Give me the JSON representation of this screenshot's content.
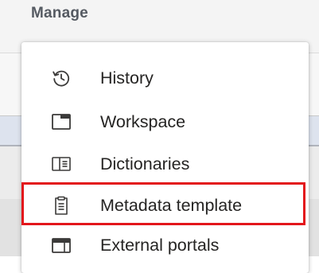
{
  "header": {
    "title": "Manage"
  },
  "menu": {
    "items": [
      {
        "icon": "history-icon",
        "label": "History"
      },
      {
        "icon": "workspace-icon",
        "label": "Workspace"
      },
      {
        "icon": "dictionaries-icon",
        "label": "Dictionaries"
      },
      {
        "icon": "metadata-template-icon",
        "label": "Metadata template",
        "highlighted": true
      },
      {
        "icon": "external-portals-icon",
        "label": "External portals"
      }
    ]
  },
  "colors": {
    "highlight_border": "#e3161b",
    "text": "#252423",
    "header_text": "#555a62",
    "background_band": "#dde3ee"
  }
}
